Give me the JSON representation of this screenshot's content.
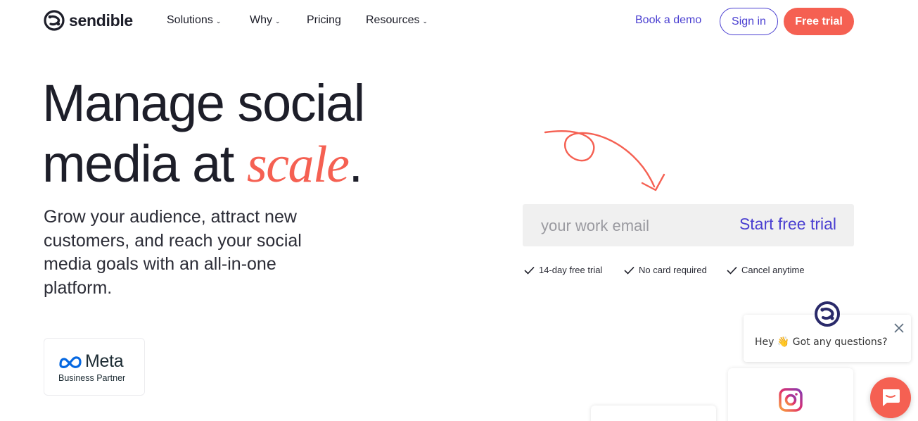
{
  "brand": {
    "name": "sendible",
    "accent": "#f56052",
    "primary": "#4a3fd1"
  },
  "nav": {
    "items": [
      {
        "label": "Solutions",
        "icon": "chevron-down-icon"
      },
      {
        "label": "Why",
        "icon": "chevron-down-icon"
      },
      {
        "label": "Pricing"
      },
      {
        "label": "Resources",
        "icon": "chevron-down-icon"
      }
    ],
    "book_demo": "Book a demo",
    "sign_in": "Sign in",
    "free_trial": "Free trial"
  },
  "hero": {
    "headline_1": "Manage social",
    "headline_2": "media at ",
    "headline_accent": "scale",
    "headline_end": ".",
    "subhead": "Grow your audience, attract new customers, and reach your social media goals with an all-in-one platform."
  },
  "badge": {
    "name": "Meta",
    "sub": "Business Partner"
  },
  "signup": {
    "placeholder": "your work email",
    "value": "",
    "button": "Start free trial",
    "checks": [
      "14-day free trial",
      "No card required",
      "Cancel anytime"
    ]
  },
  "chat": {
    "message": "Hey 👋 Got any questions?"
  }
}
